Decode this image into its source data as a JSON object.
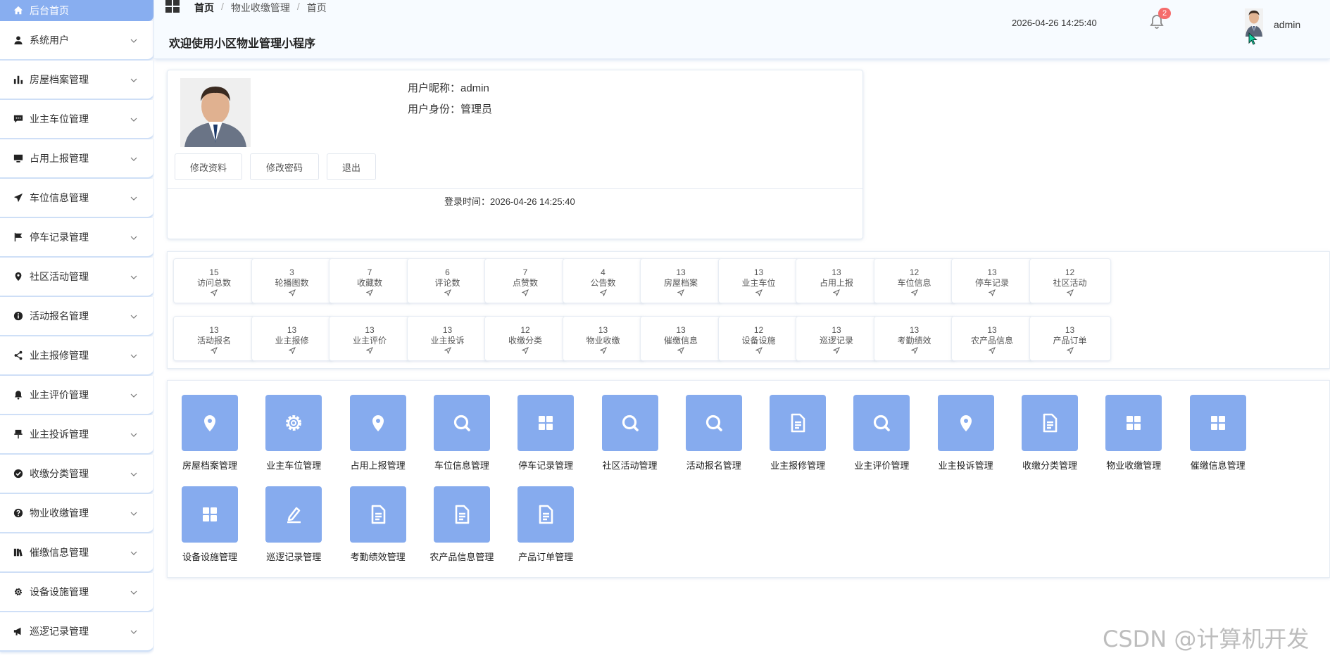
{
  "sidebar": {
    "items": [
      {
        "label": "后台首页",
        "icon": "home-icon",
        "active": true
      },
      {
        "label": "系统用户",
        "icon": "user-icon"
      },
      {
        "label": "房屋档案管理",
        "icon": "bar-chart-icon"
      },
      {
        "label": "业主车位管理",
        "icon": "chat-icon"
      },
      {
        "label": "占用上报管理",
        "icon": "monitor-icon"
      },
      {
        "label": "车位信息管理",
        "icon": "send-icon"
      },
      {
        "label": "停车记录管理",
        "icon": "flag-icon"
      },
      {
        "label": "社区活动管理",
        "icon": "map-pin-icon"
      },
      {
        "label": "活动报名管理",
        "icon": "info-icon"
      },
      {
        "label": "业主报修管理",
        "icon": "share-icon"
      },
      {
        "label": "业主评价管理",
        "icon": "bell-icon"
      },
      {
        "label": "业主投诉管理",
        "icon": "pin-icon"
      },
      {
        "label": "收缴分类管理",
        "icon": "check-circle-icon"
      },
      {
        "label": "物业收缴管理",
        "icon": "question-icon"
      },
      {
        "label": "催缴信息管理",
        "icon": "books-icon"
      },
      {
        "label": "设备设施管理",
        "icon": "gear-icon"
      },
      {
        "label": "巡逻记录管理",
        "icon": "megaphone-icon"
      }
    ]
  },
  "header": {
    "breadcrumb": [
      "首页",
      "物业收缴管理",
      "首页"
    ],
    "title": "欢迎使用小区物业管理小程序",
    "datetime": "2026-04-26 14:25:40",
    "notification_count": "2",
    "username": "admin"
  },
  "profile": {
    "nickname_line": "用户昵称：admin",
    "role_line": "用户身份：管理员",
    "buttons": [
      "修改资料",
      "修改密码",
      "退出"
    ],
    "login_time": "登录时间：2026-04-26 14:25:40"
  },
  "stats": [
    {
      "value": "15",
      "label": "访问总数"
    },
    {
      "value": "3",
      "label": "轮播图数"
    },
    {
      "value": "7",
      "label": "收藏数"
    },
    {
      "value": "6",
      "label": "评论数"
    },
    {
      "value": "7",
      "label": "点赞数"
    },
    {
      "value": "4",
      "label": "公告数"
    },
    {
      "value": "13",
      "label": "房屋档案"
    },
    {
      "value": "13",
      "label": "业主车位"
    },
    {
      "value": "13",
      "label": "占用上报"
    },
    {
      "value": "12",
      "label": "车位信息"
    },
    {
      "value": "13",
      "label": "停车记录"
    },
    {
      "value": "12",
      "label": "社区活动"
    },
    {
      "value": "13",
      "label": "活动报名"
    },
    {
      "value": "13",
      "label": "业主报修"
    },
    {
      "value": "13",
      "label": "业主评价"
    },
    {
      "value": "13",
      "label": "业主投诉"
    },
    {
      "value": "12",
      "label": "收缴分类"
    },
    {
      "value": "13",
      "label": "物业收缴"
    },
    {
      "value": "13",
      "label": "催缴信息"
    },
    {
      "value": "12",
      "label": "设备设施"
    },
    {
      "value": "13",
      "label": "巡逻记录"
    },
    {
      "value": "13",
      "label": "考勤绩效"
    },
    {
      "value": "13",
      "label": "农产品信息"
    },
    {
      "value": "13",
      "label": "产品订单"
    }
  ],
  "modules": [
    {
      "label": "房屋档案管理",
      "icon": "location-icon"
    },
    {
      "label": "业主车位管理",
      "icon": "gear-icon"
    },
    {
      "label": "占用上报管理",
      "icon": "location-icon"
    },
    {
      "label": "车位信息管理",
      "icon": "search-icon"
    },
    {
      "label": "停车记录管理",
      "icon": "grid-icon"
    },
    {
      "label": "社区活动管理",
      "icon": "search-icon"
    },
    {
      "label": "活动报名管理",
      "icon": "search-icon"
    },
    {
      "label": "业主报修管理",
      "icon": "document-icon"
    },
    {
      "label": "业主评价管理",
      "icon": "search-icon"
    },
    {
      "label": "业主投诉管理",
      "icon": "location-icon"
    },
    {
      "label": "收缴分类管理",
      "icon": "document-icon"
    },
    {
      "label": "物业收缴管理",
      "icon": "grid-icon"
    },
    {
      "label": "催缴信息管理",
      "icon": "grid-icon"
    },
    {
      "label": "设备设施管理",
      "icon": "grid-icon"
    },
    {
      "label": "巡逻记录管理",
      "icon": "edit-icon"
    },
    {
      "label": "考勤绩效管理",
      "icon": "document-icon"
    },
    {
      "label": "农产品信息管理",
      "icon": "document-icon"
    },
    {
      "label": "产品订单管理",
      "icon": "document-icon"
    }
  ],
  "watermark": "CSDN @计算机开发",
  "colors": {
    "accent": "#86abee",
    "badge": "#f56c6c"
  }
}
